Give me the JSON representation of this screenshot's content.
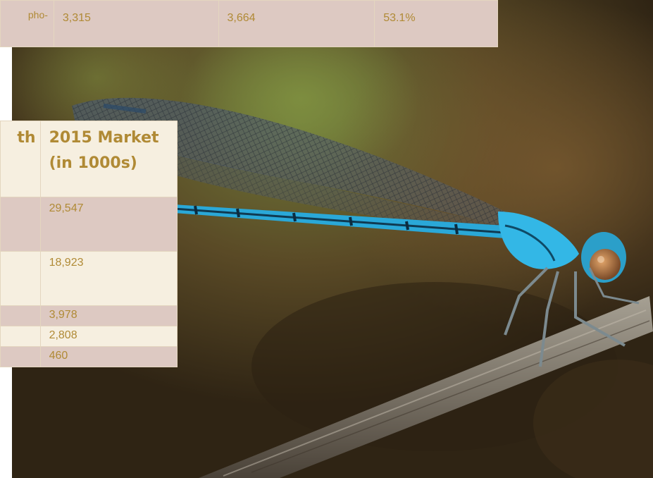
{
  "top_table": {
    "cells": [
      "pho-",
      "3,315",
      "3,664",
      "53.1%"
    ]
  },
  "mid_table": {
    "header_left": "th",
    "header_right_line1": "2015 Market",
    "header_right_line2": "(in 1000s)",
    "rows": [
      "29,547",
      "18,923",
      "3,978",
      "2,808",
      "460"
    ]
  },
  "colors": {
    "table_rose": "#ddc9c2",
    "table_cream": "#f6efe0",
    "text_gold": "#b08a35",
    "damselfly_blue": "#2aa8d8"
  }
}
